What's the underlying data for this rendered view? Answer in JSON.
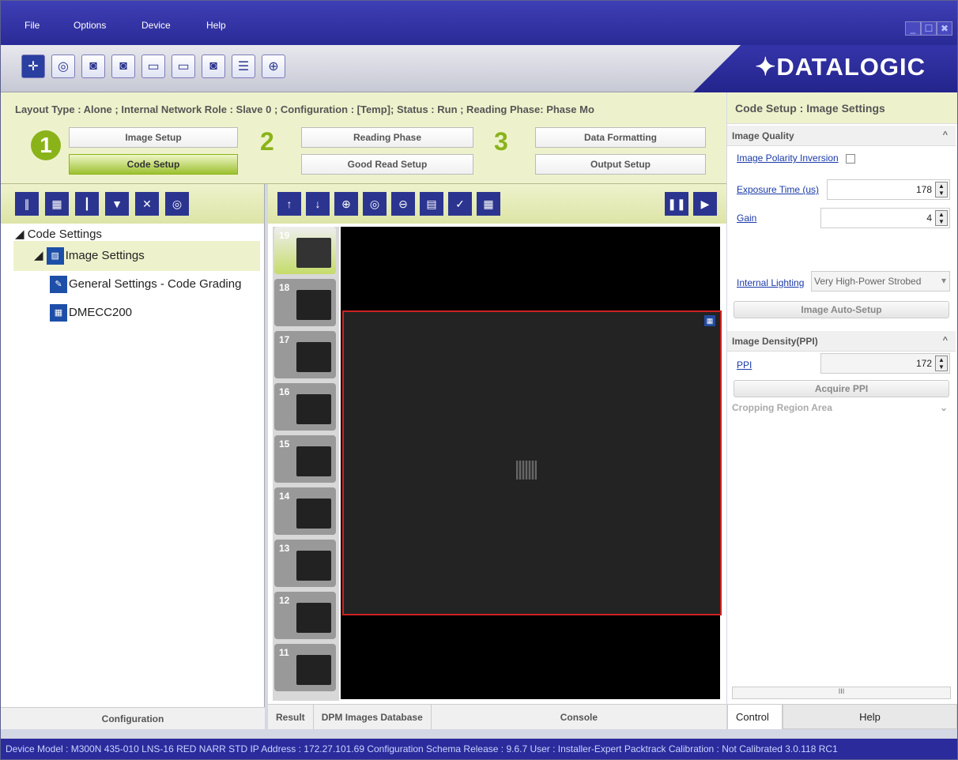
{
  "menu": [
    "File",
    "Options",
    "Device",
    "Help"
  ],
  "window_buttons": [
    "_",
    "☐",
    "✖"
  ],
  "brand": "✦DATALOGIC",
  "toolbar_icons": [
    "target-icon",
    "cameras-icon",
    "camera-send-icon",
    "camera-save-icon",
    "window-send-icon",
    "window-save-icon",
    "camera-disk-icon",
    "camera-list-icon",
    "crosshair-icon"
  ],
  "wizard": {
    "layout_line": "Layout Type : Alone ; Internal Network Role : Slave 0 ; Configuration : [Temp]; Status : Run ; Reading Phase: Phase Mo",
    "steps": [
      "1",
      "2",
      "3"
    ],
    "buttons": {
      "image_setup": "Image Setup",
      "code_setup": "Code Setup",
      "reading_phase": "Reading Phase",
      "good_read_setup": "Good Read Setup",
      "data_formatting": "Data Formatting",
      "output_setup": "Output Setup"
    }
  },
  "left": {
    "tools": [
      "barcode-icon",
      "datamatrix-icon",
      "postal-icon",
      "filter-icon",
      "delete-icon",
      "search-icon"
    ],
    "tree": {
      "root": "Code Settings",
      "image_settings": "Image Settings",
      "general": "General Settings - Code Grading",
      "dmecc": "DMECC200"
    },
    "tab": "Configuration"
  },
  "center": {
    "tools": [
      "up-arrow-icon",
      "down-arrow-icon",
      "zoom-in-icon",
      "zoom-100-icon",
      "zoom-out-icon",
      "save-image-icon",
      "check-icon",
      "grid-icon",
      "pause-icon",
      "step-icon"
    ],
    "thumbs": [
      "19",
      "18",
      "17",
      "16",
      "15",
      "14",
      "13",
      "12",
      "11"
    ],
    "tabs": [
      "Result",
      "DPM Images Database",
      "Console"
    ]
  },
  "right": {
    "title": "Code Setup : Image Settings",
    "image_quality": {
      "header": "Image Quality",
      "polarity_label": "Image Polarity Inversion",
      "exposure_label": "Exposure Time (us)",
      "exposure_value": "178",
      "gain_label": "Gain",
      "gain_value": "4",
      "lighting_label": "Internal Lighting",
      "lighting_value": "Very High-Power Strobed",
      "auto_setup": "Image Auto-Setup"
    },
    "image_density": {
      "header": "Image Density(PPI)",
      "ppi_label": "PPI",
      "ppi_value": "172",
      "acquire": "Acquire PPI"
    },
    "cropping": "Cropping Region Area",
    "scroll_label": "III",
    "tabs": [
      "Control",
      "Help"
    ]
  },
  "status": "Device Model : M300N 435-010 LNS-16 RED NARR STD   IP Address : 172.27.101.69   Configuration Schema Release : 9.6.7   User : Installer-Expert   Packtrack Calibration : Not Calibrated 3.0.118 RC1"
}
